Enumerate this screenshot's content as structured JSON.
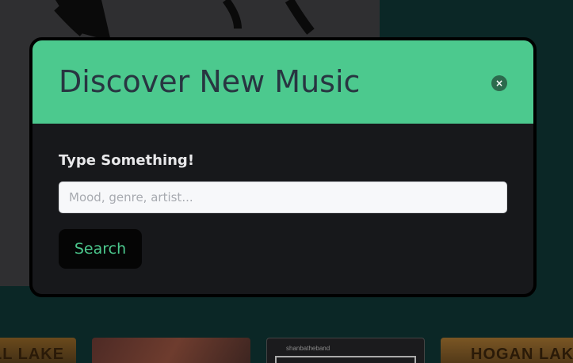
{
  "modal": {
    "title": "Discover New Music",
    "close_label": "×",
    "field_label": "Type Something!",
    "search_placeholder": "Mood, genre, artist...",
    "search_value": "",
    "search_button_label": "Search"
  },
  "background_cards": [
    {
      "text": "LL LAKE"
    },
    {
      "text": ""
    },
    {
      "text": "shanbatheband"
    },
    {
      "text": "HOGAN LAKE"
    }
  ],
  "colors": {
    "accent": "#4cc98e",
    "modal_body": "#17181b",
    "page_background": "#0b2726",
    "title_text": "#283541"
  }
}
